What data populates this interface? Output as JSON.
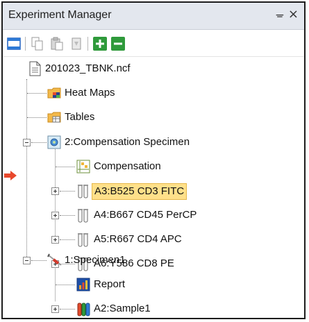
{
  "window": {
    "title": "Experiment Manager",
    "pin_glyph": "ᚚ",
    "close_glyph": "×"
  },
  "toolbar": {
    "buttons": [
      {
        "icon": "layout-window-icon"
      },
      {
        "icon": "copy-icon"
      },
      {
        "icon": "paste-icon"
      },
      {
        "icon": "duplicate-icon"
      },
      {
        "icon": "add-icon"
      },
      {
        "icon": "remove-icon"
      }
    ]
  },
  "tree": {
    "root": {
      "label": "201023_TBNK.ncf",
      "icon": "file-icon"
    },
    "heat_maps": {
      "label": "Heat Maps",
      "icon": "folder-heatmap-icon"
    },
    "tables": {
      "label": "Tables",
      "icon": "folder-table-icon"
    },
    "compensation_specimen": {
      "label": "2:Compensation Specimen",
      "icon": "compensation-specimen-icon"
    },
    "compensation": {
      "label": "Compensation",
      "icon": "compensation-matrix-icon"
    },
    "tube_a3": {
      "label": "A3:B525 CD3 FITC",
      "icon": "tube-icon",
      "selected": true
    },
    "tube_a4": {
      "label": "A4:B667 CD45 PerCP",
      "icon": "tube-icon"
    },
    "tube_a5": {
      "label": "A5:R667 CD4 APC",
      "icon": "tube-icon"
    },
    "tube_a6": {
      "label": "A6:Y586 CD8 PE",
      "icon": "tube-icon"
    },
    "specimen1": {
      "label": "1:Specimen1",
      "icon": "syringe-icon"
    },
    "report": {
      "label": "Report",
      "icon": "report-icon"
    },
    "sample1": {
      "label": "A2:Sample1",
      "icon": "color-tube-icon"
    }
  },
  "colors": {
    "selection": "#ffe08a",
    "current_arrow": "#e8482c",
    "add_green": "#2f9a3b"
  }
}
